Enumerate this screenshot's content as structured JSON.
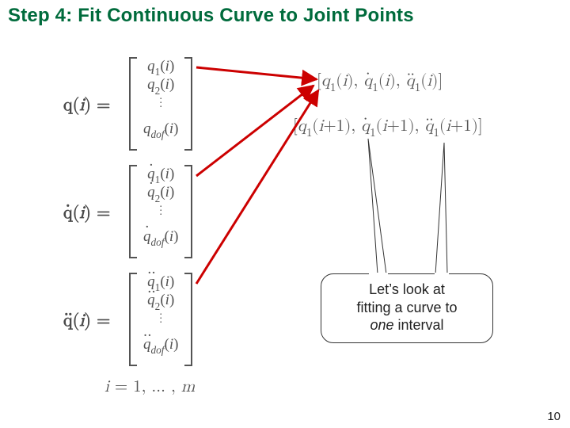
{
  "title": "Step 4: Fit Continuous Curve to Joint Points",
  "lhs": {
    "q": "q(i) =",
    "qdot": "q̇(i) =",
    "qddot": "q̈(i) ="
  },
  "vectors": {
    "q": {
      "r1": "q₁(i)",
      "r2": "q₂(i)",
      "r3": "q_dof(i)"
    },
    "qdot": {
      "r1": "q̇₁(i)",
      "r2": "q̇₂(i)",
      "r3": "q̇_dof(i)"
    },
    "qddot": {
      "r1": "q̈₁(i)",
      "r2": "q̈₂(i)",
      "r3": "q̈_dof(i)"
    }
  },
  "rhs": {
    "tuple_i": "[q₁(i), q̇₁(i), q̈₁(i)]",
    "tuple_iplus1": "[q₁(i+1), q̇₁(i+1), q̈₁(i+1)]"
  },
  "index_line": "i = 1, … , m",
  "callout": {
    "line1": "Let’s look at",
    "line2": "fitting a curve to",
    "line3_a": "one",
    "line3_b": " interval"
  },
  "page_number": "10"
}
